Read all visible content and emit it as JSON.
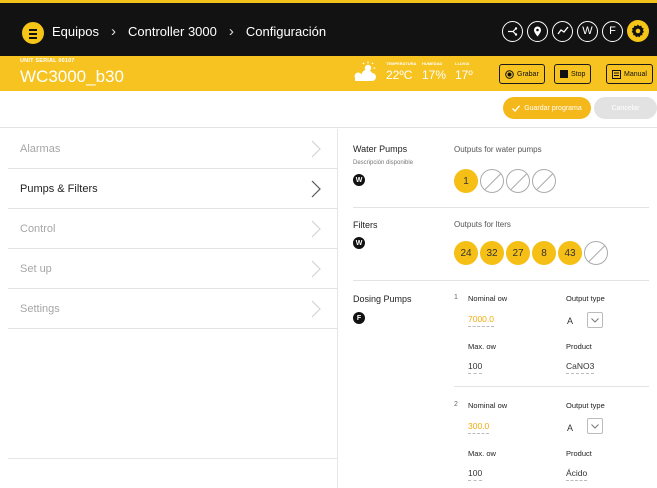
{
  "nav": {
    "breadcrumbs": [
      "Equipos",
      "Controller 3000",
      "Configuración"
    ],
    "icons": [
      "network-icon",
      "location-icon",
      "trend-icon",
      "W",
      "F",
      "settings-gear-icon"
    ],
    "icon_letters": {
      "w": "W",
      "f": "F"
    }
  },
  "unit": {
    "serial_label": "UNIT SERIAL 00107",
    "name": "WC3000_b30"
  },
  "weather": {
    "temperature": {
      "label": "TEMPERATURA",
      "value": "22ºC"
    },
    "humidity": {
      "label": "HUMEDAD",
      "value": "17%"
    },
    "rain": {
      "label": "LLUVIA",
      "value": "17º"
    }
  },
  "controls": {
    "record": "Grabar",
    "stop": "Stop",
    "manual": "Manual"
  },
  "actions": {
    "save": "Guardar programa",
    "cancel": "Cancelar"
  },
  "sidebar": {
    "items": [
      {
        "label": "Alarmas",
        "active": false
      },
      {
        "label": "Pumps & Filters",
        "active": true
      },
      {
        "label": "Control",
        "active": false
      },
      {
        "label": "Set up",
        "active": false
      },
      {
        "label": "Settings",
        "active": false
      }
    ]
  },
  "water_pumps": {
    "title": "Water Pumps",
    "subtitle": "Descripción disponible",
    "badge": "W",
    "outputs_title": "Outputs for water pumps",
    "outputs": [
      "1",
      "",
      "",
      ""
    ]
  },
  "filters": {
    "title": "Filters",
    "badge": "W",
    "outputs_title": "Outputs for  lters",
    "outputs": [
      "24",
      "32",
      "27",
      "8",
      "43",
      ""
    ]
  },
  "dosing_pumps": {
    "title": "Dosing Pumps",
    "badge": "F",
    "labels": {
      "nominal_flow": "Nominal  ow",
      "output_type": "Output type",
      "max_flow": "Max.  ow",
      "product": "Product"
    },
    "pumps": [
      {
        "index": "1",
        "nominal_flow": "7000.0",
        "output_type": "A",
        "max_flow": "100",
        "product": "CaNO3"
      },
      {
        "index": "2",
        "nominal_flow": "300.0",
        "output_type": "A",
        "max_flow": "100",
        "product": "Ácido"
      }
    ]
  },
  "colors": {
    "accent": "#f5bf16",
    "nav_bg": "#121212",
    "unit_bar": "#f6c320"
  }
}
